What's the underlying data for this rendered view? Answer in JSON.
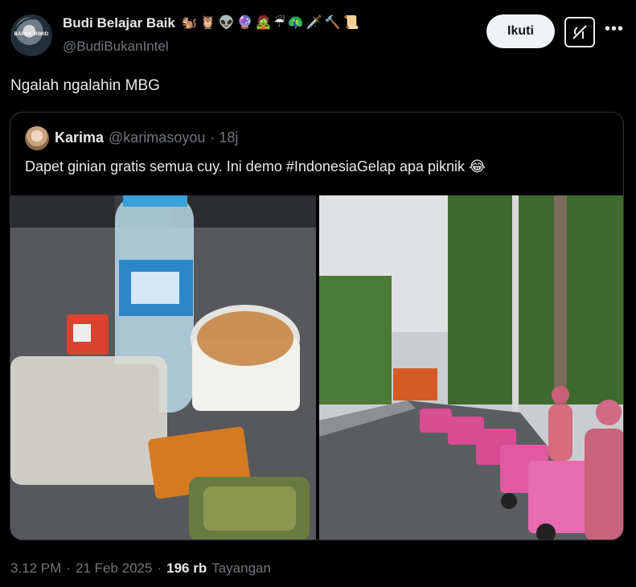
{
  "author": {
    "name": "Budi Belajar Baik",
    "handle": "@BudiBukanIntel",
    "avatar_text": "BAPAK RIMID",
    "emojis": [
      "🐿️",
      "🦉",
      "👽",
      "🔮",
      "🧟",
      "☔",
      "🦚",
      "🗡️",
      "🔨",
      "📜"
    ]
  },
  "actions": {
    "follow_label": "Ikuti",
    "grok_icon": "grok-icon",
    "more_icon": "more-icon"
  },
  "tweet": {
    "text": "Ngalah ngalahin MBG"
  },
  "quote": {
    "name": "Karima",
    "handle": "@karimasoyou",
    "time": "· 18j",
    "text": "Dapet ginian gratis semua cuy. Ini demo #IndonesiaGelap apa piknik 😂"
  },
  "footer": {
    "time": "3.12 PM",
    "separator1": "·",
    "date": "21 Feb 2025",
    "separator2": "·",
    "views_count": "196 rb",
    "views_label": "Tayangan"
  }
}
